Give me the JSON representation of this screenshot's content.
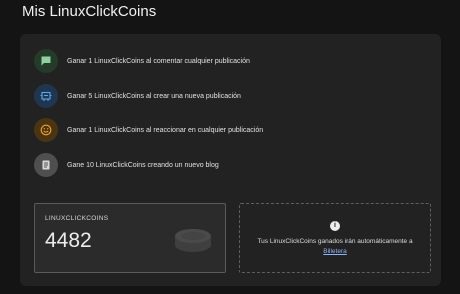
{
  "page": {
    "title": "Mis LinuxClickCoins"
  },
  "earn_items": [
    {
      "icon": "comment-icon",
      "text": "Ganar 1 LinuxClickCoins al comentar cualquier publicación"
    },
    {
      "icon": "post-icon",
      "text": "Ganar 5 LinuxClickCoins al crear una nueva publicación"
    },
    {
      "icon": "smiley-icon",
      "text": "Ganar 1 LinuxClickCoins al reaccionar en cualquier publicación"
    },
    {
      "icon": "blog-icon",
      "text": "Gane 10 LinuxClickCoins creando un nuevo blog"
    }
  ],
  "balance": {
    "label": "LINUXCLICKCOINS",
    "value": "4482",
    "icon": "coins-icon"
  },
  "info": {
    "icon": "info-icon",
    "text": "Tus LinuxClickCoins ganados irán automáticamente a",
    "link_text": "Billetera"
  },
  "colors": {
    "background": "#141414",
    "card": "#222222",
    "comment_icon": "#8fd19e",
    "post_icon": "#5aa9e6",
    "smiley_icon": "#f2a52b",
    "blog_icon": "#d9d9d9",
    "link": "#8ab4f8"
  }
}
